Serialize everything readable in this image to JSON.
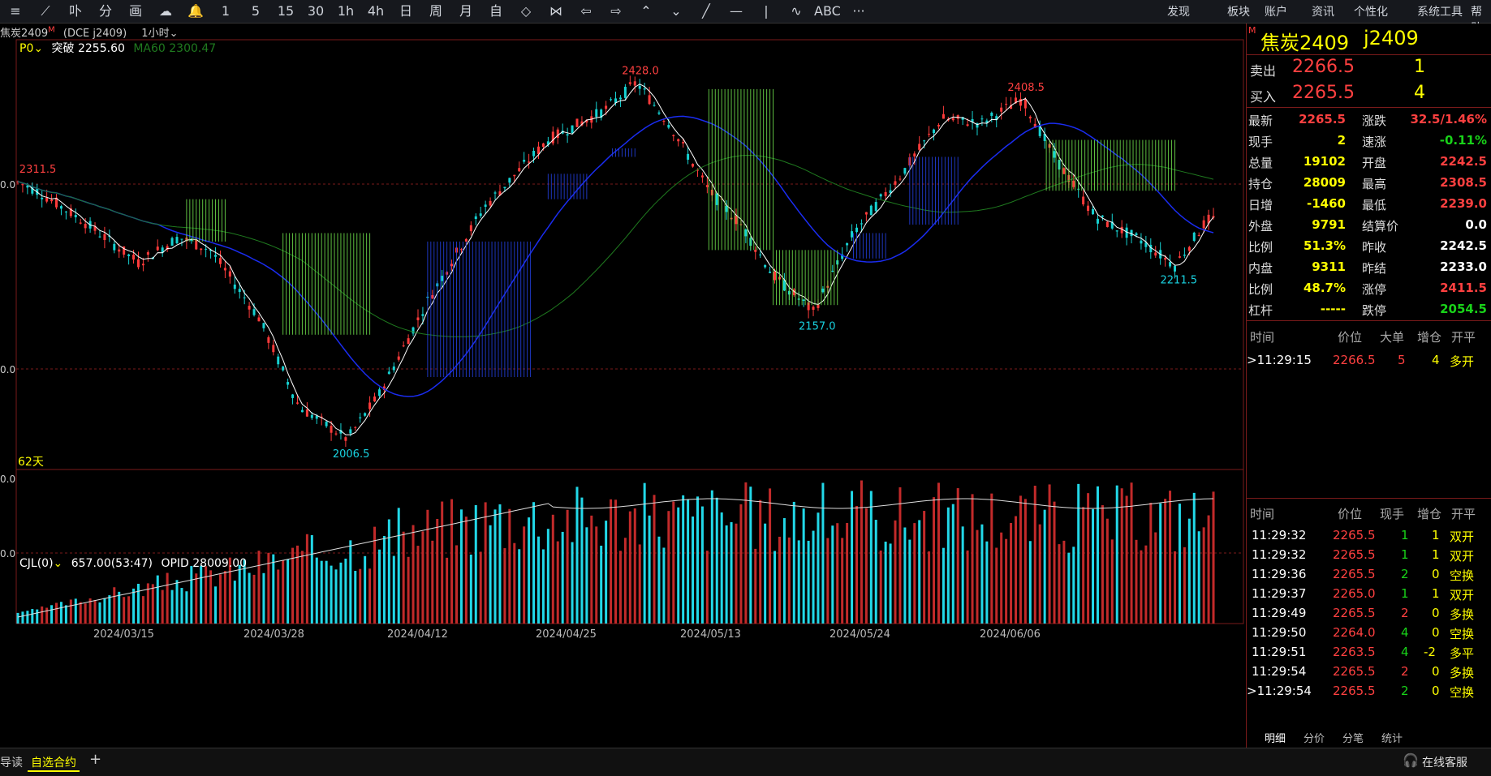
{
  "toolbar": {
    "tools": [
      "≡",
      "⟋",
      "卟",
      "分",
      "画",
      "☁",
      "🔔",
      "1",
      "5",
      "15",
      "30",
      "1h",
      "4h",
      "日",
      "周",
      "月",
      "自",
      "◇",
      "⋈",
      "⇦",
      "⇨",
      "⌃",
      "⌄",
      "╱",
      "—",
      "|",
      "∿",
      "ABC",
      "···"
    ],
    "menu": [
      "发现",
      "板块",
      "账户",
      "资讯",
      "个性化",
      "系统工具",
      "帮助"
    ]
  },
  "chart_header": {
    "instrument": "焦炭2409",
    "sup": "M",
    "code": "(DCE j2409)",
    "period": "1小时",
    "indicator": "P0",
    "break_label": "突破 2255.60",
    "ma60": "MA60 2300.47"
  },
  "main_chart": {
    "price_labels": [
      "2428.0",
      "2408.5",
      "2311.5",
      "2157.0",
      "2211.5",
      "2006.5"
    ],
    "axis_left": [
      "0.0",
      "0.0"
    ],
    "days_label": "62天"
  },
  "volume_chart": {
    "indicator": "CJL(0)",
    "values": "657.00(53:47)",
    "opid": "OPID 28009.00",
    "axis_left": [
      "0.0",
      "0.0"
    ]
  },
  "chart_data": {
    "type": "candlestick",
    "x_labels": [
      "2024/03/15",
      "2024/03/28",
      "2024/04/12",
      "2024/04/25",
      "2024/05/13",
      "2024/05/24",
      "2024/06/06"
    ],
    "key_points": [
      {
        "label": "2311.5",
        "value": 2311.5
      },
      {
        "label": "2006.5",
        "value": 2006.5
      },
      {
        "label": "2428.0",
        "value": 2428.0
      },
      {
        "label": "2157.0",
        "value": 2157.0
      },
      {
        "label": "2408.5",
        "value": 2408.5
      },
      {
        "label": "2211.5",
        "value": 2211.5
      }
    ],
    "ma60_last": 2300.47,
    "last_price": 2265.5
  },
  "quote": {
    "title": "焦炭2409",
    "code": "j2409",
    "ask_label": "卖出",
    "ask_price": "2266.5",
    "ask_vol": "1",
    "bid_label": "买入",
    "bid_price": "2265.5",
    "bid_vol": "4",
    "rows": [
      {
        "l1": "最新",
        "v1": "2265.5",
        "c1": "red",
        "l2": "涨跌",
        "v2": "32.5/1.46%",
        "c2": "red"
      },
      {
        "l1": "现手",
        "v1": "2",
        "c1": "yellow",
        "l2": "速涨",
        "v2": "-0.11%",
        "c2": "green"
      },
      {
        "l1": "总量",
        "v1": "19102",
        "c1": "yellow",
        "l2": "开盘",
        "v2": "2242.5",
        "c2": "red"
      },
      {
        "l1": "持仓",
        "v1": "28009",
        "c1": "yellow",
        "l2": "最高",
        "v2": "2308.5",
        "c2": "red"
      },
      {
        "l1": "日增",
        "v1": "-1460",
        "c1": "yellow",
        "l2": "最低",
        "v2": "2239.0",
        "c2": "red"
      },
      {
        "l1": "外盘",
        "v1": "9791",
        "c1": "yellow",
        "l2": "结算价",
        "v2": "0.0",
        "c2": "white"
      },
      {
        "l1": "比例",
        "v1": "51.3%",
        "c1": "yellow",
        "l2": "昨收",
        "v2": "2242.5",
        "c2": "white"
      },
      {
        "l1": "内盘",
        "v1": "9311",
        "c1": "yellow",
        "l2": "昨结",
        "v2": "2233.0",
        "c2": "white"
      },
      {
        "l1": "比例",
        "v1": "48.7%",
        "c1": "yellow",
        "l2": "涨停",
        "v2": "2411.5",
        "c2": "red"
      },
      {
        "l1": "杠杆",
        "v1": "-----",
        "c1": "yellow",
        "l2": "跌停",
        "v2": "2054.5",
        "c2": "green"
      }
    ]
  },
  "big_trades": {
    "headers": [
      "时间",
      "价位",
      "大单",
      "增仓",
      "开平"
    ],
    "rows": [
      {
        "time": ">11:29:15",
        "price": "2266.5",
        "big": "5",
        "inc": "4",
        "type": "多开"
      }
    ]
  },
  "ticks": {
    "headers": [
      "时间",
      "价位",
      "现手",
      "增仓",
      "开平"
    ],
    "rows": [
      {
        "time": "11:29:32",
        "price": "2265.5",
        "vol": "1",
        "inc": "1",
        "type": "双开",
        "pc": "red",
        "vc": "green"
      },
      {
        "time": "11:29:32",
        "price": "2265.5",
        "vol": "1",
        "inc": "1",
        "type": "双开",
        "pc": "red",
        "vc": "green"
      },
      {
        "time": "11:29:36",
        "price": "2265.5",
        "vol": "2",
        "inc": "0",
        "type": "空换",
        "pc": "red",
        "vc": "green"
      },
      {
        "time": "11:29:37",
        "price": "2265.0",
        "vol": "1",
        "inc": "1",
        "type": "双开",
        "pc": "red",
        "vc": "green"
      },
      {
        "time": "11:29:49",
        "price": "2265.5",
        "vol": "2",
        "inc": "0",
        "type": "多换",
        "pc": "red",
        "vc": "red"
      },
      {
        "time": "11:29:50",
        "price": "2264.0",
        "vol": "4",
        "inc": "0",
        "type": "空换",
        "pc": "red",
        "vc": "green"
      },
      {
        "time": "11:29:51",
        "price": "2263.5",
        "vol": "4",
        "inc": "-2",
        "type": "多平",
        "pc": "red",
        "vc": "green"
      },
      {
        "time": "11:29:54",
        "price": "2265.5",
        "vol": "2",
        "inc": "0",
        "type": "多换",
        "pc": "red",
        "vc": "red"
      },
      {
        "time": ">11:29:54",
        "price": "2265.5",
        "vol": "2",
        "inc": "0",
        "type": "空换",
        "pc": "red",
        "vc": "green"
      }
    ]
  },
  "right_tabs": [
    "明细",
    "分价",
    "分笔",
    "统计"
  ],
  "bottom": {
    "left_label": "导读",
    "tab": "自选合约",
    "add": "+",
    "service": "在线客服"
  },
  "colors": {
    "up": "#ff3b3b",
    "down": "#16d2d2",
    "ma_blue": "#1a2cf0",
    "ma_white": "#ffffff",
    "ma60": "#1f7a1f",
    "bar_green": "#6fe14c",
    "bar_blue": "#2440e0",
    "grid_red": "#7a1a1a"
  }
}
